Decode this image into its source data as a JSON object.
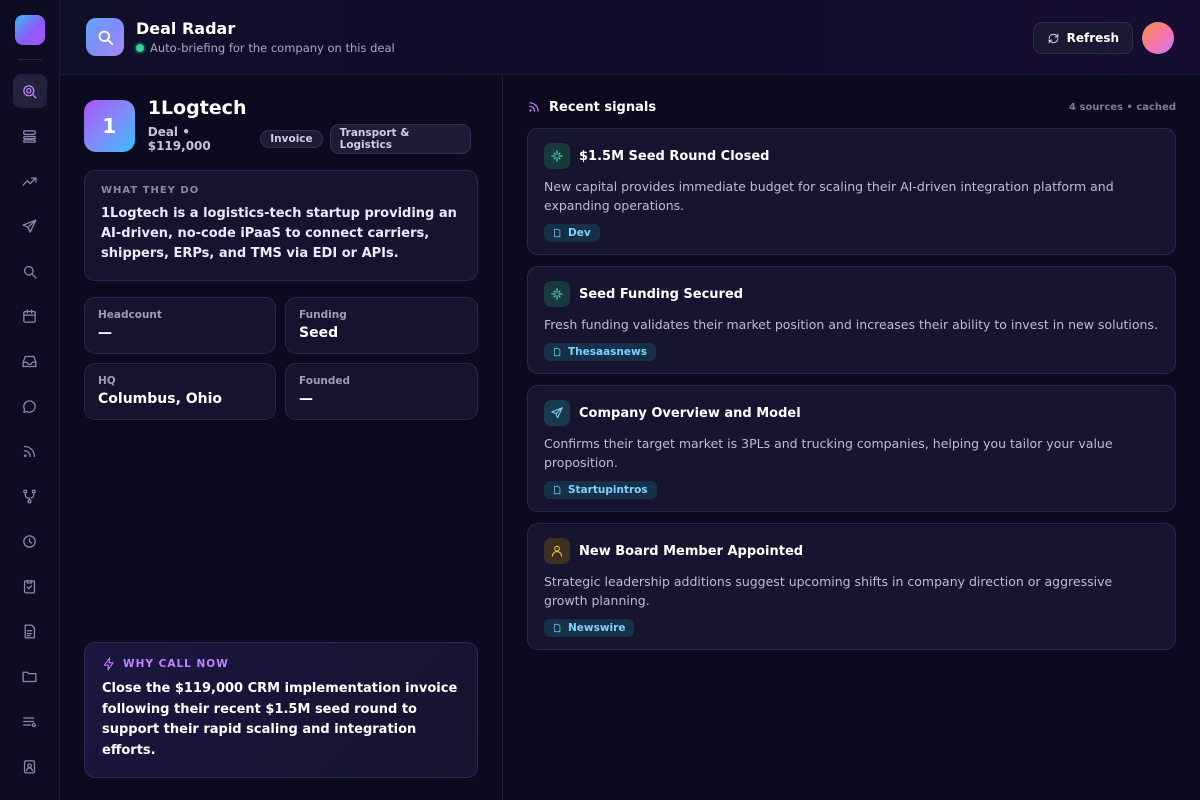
{
  "app": {
    "title": "Deal Radar",
    "subtitle": "Auto-briefing for the company on this deal",
    "refresh_label": "Refresh"
  },
  "sidebar": {
    "items": [
      {
        "icon": "radar-icon",
        "active": true
      },
      {
        "icon": "layers-icon",
        "active": false
      },
      {
        "icon": "trending-up-icon",
        "active": false
      },
      {
        "icon": "send-icon",
        "active": false
      },
      {
        "icon": "search-icon",
        "active": false
      },
      {
        "icon": "calendar-icon",
        "active": false
      },
      {
        "icon": "inbox-icon",
        "active": false
      },
      {
        "icon": "chat-icon",
        "active": false
      },
      {
        "icon": "rss-icon",
        "active": false
      },
      {
        "icon": "git-branch-icon",
        "active": false
      },
      {
        "icon": "clock-icon",
        "active": false
      },
      {
        "icon": "clipboard-check-icon",
        "active": false
      },
      {
        "icon": "document-icon",
        "active": false
      },
      {
        "icon": "folder-icon",
        "active": false
      },
      {
        "icon": "list-icon",
        "active": false
      },
      {
        "icon": "contact-badge-icon",
        "active": false
      }
    ]
  },
  "company": {
    "badge": "1",
    "name": "1Logtech",
    "deal": "Deal • $119,000",
    "tags": [
      "Invoice",
      "Transport & Logistics"
    ],
    "what_label": "WHAT THEY DO",
    "what_text": "1Logtech is a logistics-tech startup providing an AI-driven, no-code iPaaS to connect carriers, shippers, ERPs, and TMS via EDI or APIs.",
    "stats": [
      {
        "label": "Headcount",
        "value": "—"
      },
      {
        "label": "Funding",
        "value": "Seed"
      },
      {
        "label": "HQ",
        "value": "Columbus, Ohio"
      },
      {
        "label": "Founded",
        "value": "—"
      }
    ]
  },
  "why": {
    "label": "WHY CALL NOW",
    "text": "Close the $119,000 CRM implementation invoice following their recent $1.5M seed round to support their rapid scaling and integration efforts."
  },
  "signals": {
    "title": "Recent signals",
    "meta": "4 sources • cached",
    "items": [
      {
        "icon": "sparkle-icon",
        "icon_color": "#5eead4",
        "title": "$1.5M Seed Round Closed",
        "desc": "New capital provides immediate budget for scaling their AI-driven integration platform and expanding operations.",
        "source": "Dev"
      },
      {
        "icon": "sparkle-icon",
        "icon_color": "#5eead4",
        "title": "Seed Funding Secured",
        "desc": "Fresh funding validates their market position and increases their ability to invest in new solutions.",
        "source": "Thesaasnews"
      },
      {
        "icon": "send-icon",
        "icon_color": "#7dd3fc",
        "title": "Company Overview and Model",
        "desc": "Confirms their target market is 3PLs and trucking companies, helping you tailor your value proposition.",
        "source": "Startupintros"
      },
      {
        "icon": "user-icon",
        "icon_color": "#fbbf24",
        "title": "New Board Member Appointed",
        "desc": "Strategic leadership additions suggest upcoming shifts in company direction or aggressive growth planning.",
        "source": "Newswire"
      }
    ]
  }
}
